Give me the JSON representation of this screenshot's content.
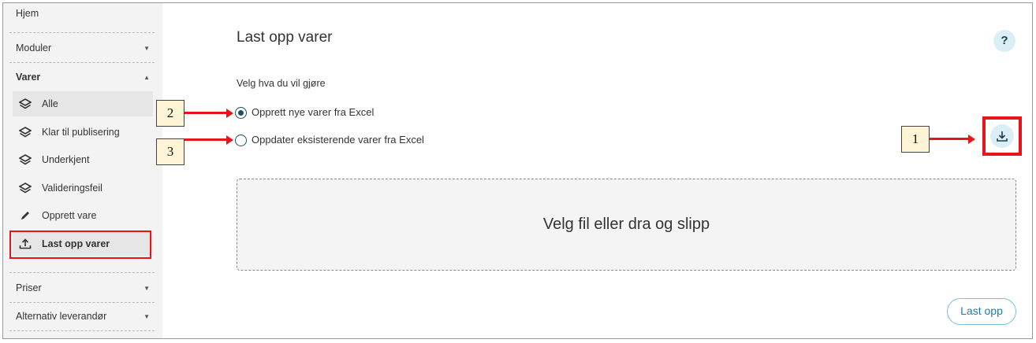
{
  "sidebar": {
    "home": "Hjem",
    "sections": {
      "modules": "Moduler",
      "products": "Varer",
      "prices": "Priser",
      "alt_supplier": "Alternativ leverandør"
    },
    "items": [
      {
        "label": "Alle",
        "icon": "layers-icon"
      },
      {
        "label": "Klar til publisering",
        "icon": "layers-icon"
      },
      {
        "label": "Underkjent",
        "icon": "layers-icon"
      },
      {
        "label": "Valideringsfeil",
        "icon": "layers-icon"
      },
      {
        "label": "Opprett vare",
        "icon": "pencil-icon"
      },
      {
        "label": "Last opp varer",
        "icon": "upload-icon"
      }
    ]
  },
  "main": {
    "title": "Last opp varer",
    "help_label": "?",
    "prompt": "Velg hva du vil gjøre",
    "options": [
      {
        "label": "Opprett nye varer fra Excel",
        "checked": true
      },
      {
        "label": "Oppdater eksisterende varer fra Excel",
        "checked": false
      }
    ],
    "dropzone_text": "Velg fil eller dra og slipp",
    "upload_button": "Last opp"
  },
  "callouts": {
    "one": "1",
    "two": "2",
    "three": "3"
  },
  "colors": {
    "accent": "#1f4e66",
    "highlight": "#e8141c",
    "callout_bg": "#fff5d6",
    "button_text": "#1d7ea6"
  }
}
